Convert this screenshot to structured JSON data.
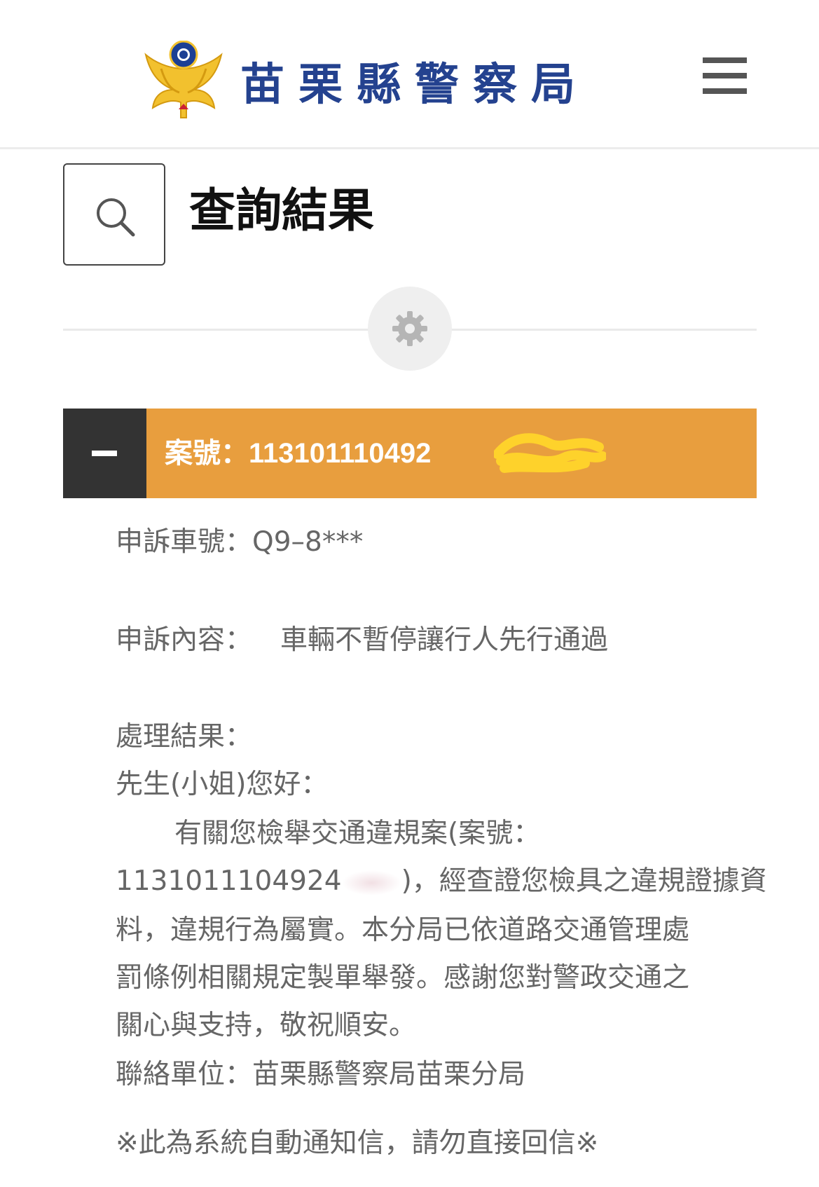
{
  "header": {
    "site_name": "苗栗縣警察局",
    "logo_icon": "police-emblem-icon",
    "menu_icon": "hamburger-menu-icon"
  },
  "page": {
    "title": "查詢結果",
    "search_icon": "search-icon",
    "settings_icon": "gear-icon"
  },
  "case": {
    "label": "案號：",
    "number": "113101110492",
    "toggle_icon": "minus-icon",
    "bar_color": "#e89e3e"
  },
  "details": {
    "plate_label": "申訴車號：",
    "plate_value": "Q9–8***",
    "content_label": "申訴內容：",
    "content_value": "車輛不暫停讓行人先行通過",
    "result_label": "處理結果：",
    "greeting": "先生(小姐)您好：",
    "body_line1": "有關您檢舉交通違規案(案號：",
    "body_line2_start": "1131011104924",
    "body_line2_end": ")，經查證您檢具之違規證據資",
    "body_line3": "料，違規行為屬實。本分局已依道路交通管理處",
    "body_line4": "罰條例相關規定製單舉發。感謝您對警政交通之",
    "body_line5": "關心與支持，敬祝順安。",
    "contact": "聯絡單位：苗栗縣警察局苗栗分局",
    "notice": "※此為系統自動通知信，請勿直接回信※"
  }
}
